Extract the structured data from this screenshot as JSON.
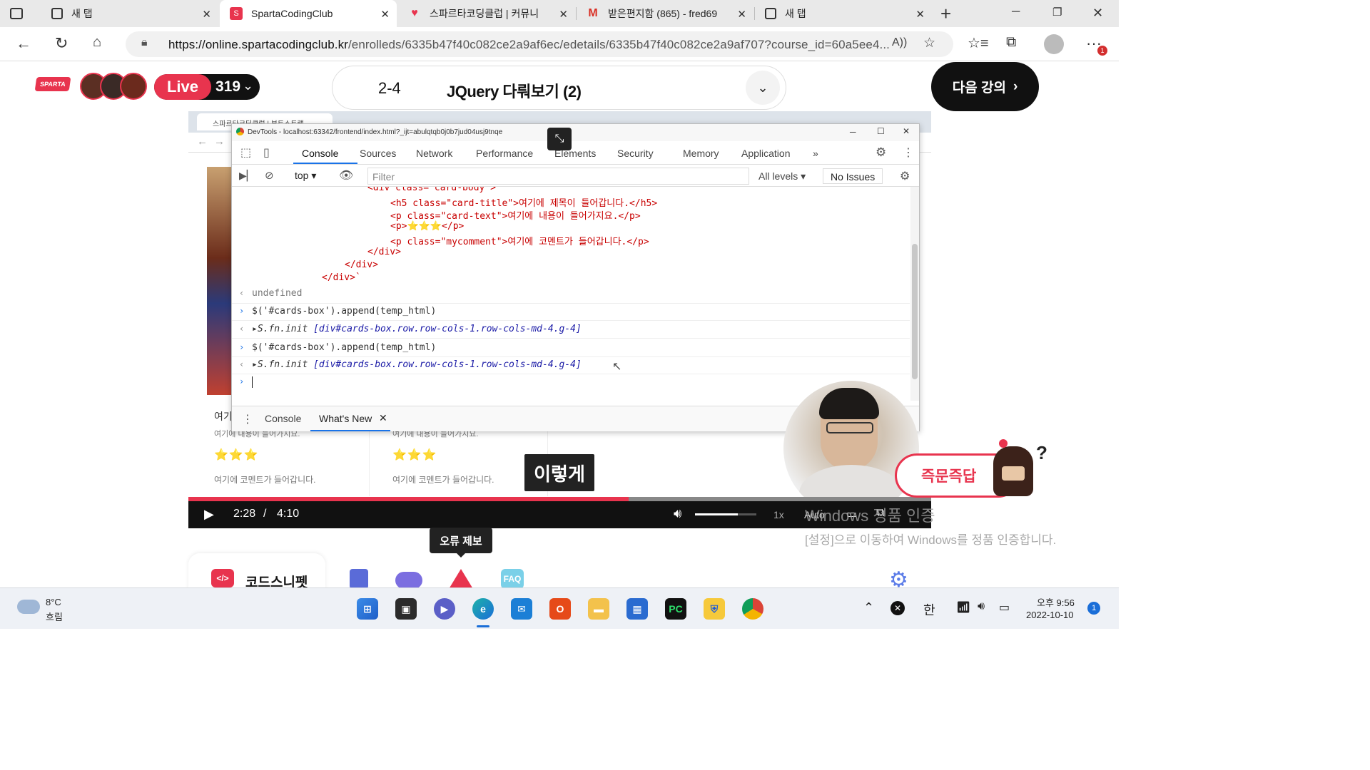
{
  "browser": {
    "tabs": [
      {
        "title": "새 탭"
      },
      {
        "title": "SpartaCodingClub"
      },
      {
        "title": "스파르타코딩클럽 | 커뮤니"
      },
      {
        "title": "받은편지함 (865) - fred69"
      },
      {
        "title": "새 탭"
      }
    ],
    "url_host": "https://online.spartacodingclub.kr",
    "url_path": "/enrolleds/6335b47f40c082ce2a9af6ec/edetails/6335b47f40c082ce2a9af707?course_id=60a5ee4...",
    "menu_badge": "1"
  },
  "header": {
    "logo_text": "SPARTA",
    "live_label": "Live",
    "live_count": "319",
    "lecture_number": "2-4",
    "lecture_title": "JQuery 다뤄보기 (2)",
    "next_button": "다음 강의"
  },
  "video": {
    "inner_tab_title": "스파르타코딩클럽 | 부트스트랩",
    "devtools": {
      "title": "DevTools - localhost:63342/frontend/index.html?_ijt=abulqtqb0j0b7jud04usj9tnqe",
      "tabs": [
        "Console",
        "Sources",
        "Network",
        "Performance",
        "Elements",
        "Security",
        "Memory",
        "Application"
      ],
      "context": "top",
      "filter_placeholder": "Filter",
      "levels": "All levels",
      "issues": "No Issues",
      "lines": {
        "l0": "<div class= card-body >",
        "l1": "<h5 class=\"card-title\">여기에 제목이 들어갑니다.</h5>",
        "l2": "<p class=\"card-text\">여기에 내용이 들어가지요.</p>",
        "l3": "<p>⭐⭐⭐</p>",
        "l4": "<p class=\"mycomment\">여기에 코멘트가 들어갑니다.</p>",
        "l5": "</div>",
        "l6": "</div>",
        "l7": "</div>`",
        "undefined": "undefined",
        "cmd1": "$('#cards-box').append(temp_html)",
        "res1_prefix": "S.fn.init ",
        "res1": "[div#cards-box.row.row-cols-1.row-cols-md-4.g-4]",
        "cmd2": "$('#cards-box').append(temp_html)",
        "res2_prefix": "S.fn.init ",
        "res2": "[div#cards-box.row.row-cols-1.row-cols-md-4.g-4]"
      },
      "drawer_tabs": [
        "Console",
        "What's New"
      ]
    },
    "cards": [
      {
        "text_top": "여기",
        "text": "여기에 내용이 들어가지요.",
        "stars": "⭐⭐⭐",
        "comment": "여기에 코멘트가 들어갑니다."
      },
      {
        "text_top": "",
        "text": "여기에 내용이 들어가지요.",
        "stars": "⭐⭐⭐",
        "comment": "여기에 코멘트가 들어갑니다."
      }
    ],
    "subtitle": "이렇게",
    "current_time": "2:28",
    "separator": "/",
    "duration": "4:10",
    "progress_fraction": 0.593,
    "volume_fraction": 0.7,
    "speed": "1x",
    "quality": "Auto"
  },
  "quick_answer_button": "즉문즉답",
  "error_report_tooltip": "오류 제보",
  "watermark": {
    "line1": "Windows 정품 인증",
    "line2": "[설정]으로 이동하여 Windows를 정품 인증합니다."
  },
  "tools": {
    "snippet_label": "코드스니펫",
    "faq_label": "FAQ"
  },
  "taskbar": {
    "weather_temp": "8°C",
    "weather_desc": "흐림",
    "ime": "한",
    "time": "오후 9:56",
    "date": "2022-10-10",
    "notification_count": "1"
  },
  "colors": {
    "brand": "#e8344e",
    "dark": "#111111"
  }
}
